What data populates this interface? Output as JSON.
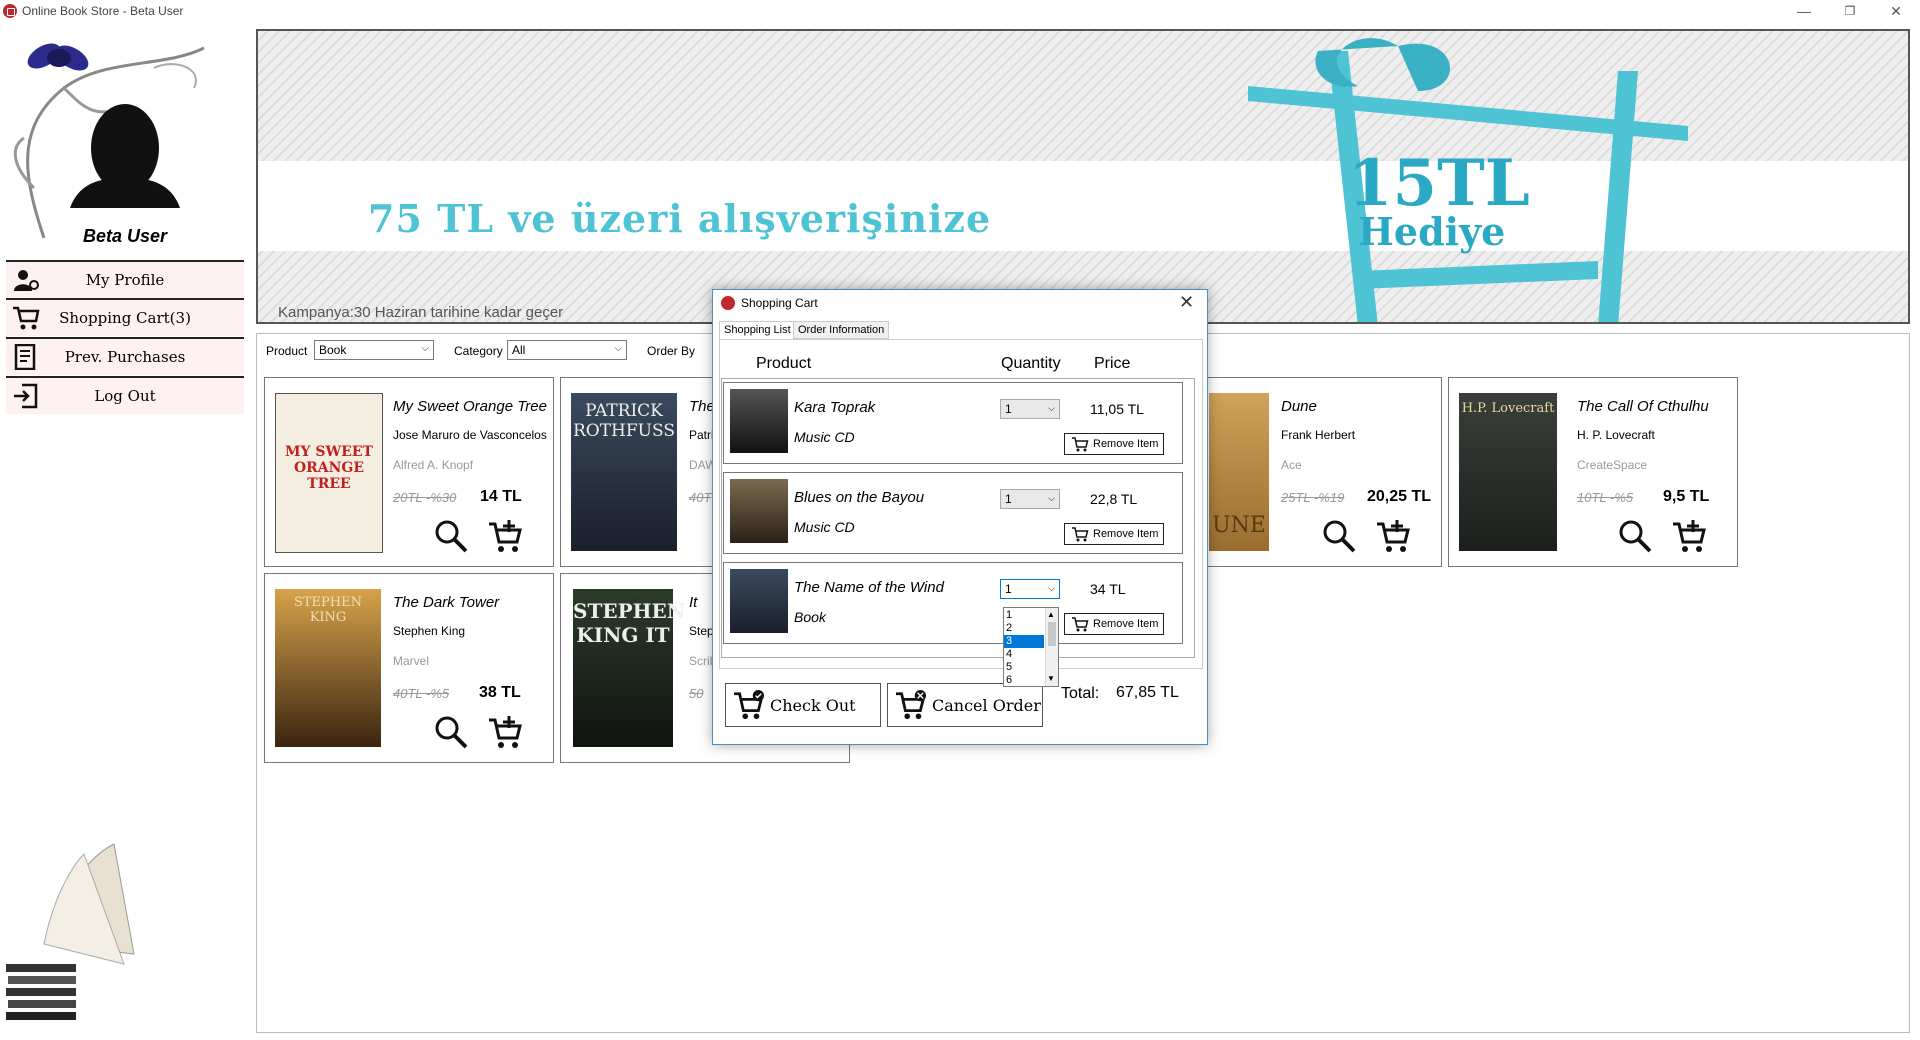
{
  "window": {
    "title": "Online Book Store - Beta User",
    "minimize": "—",
    "restore": "❐",
    "close": "✕"
  },
  "sidebar": {
    "user_name": "Beta User",
    "items": [
      {
        "label": "My Profile",
        "icon": "user-gear-icon"
      },
      {
        "label": "Shopping Cart(3)",
        "icon": "shopping-cart-icon"
      },
      {
        "label": "Prev. Purchases",
        "icon": "receipt-icon"
      },
      {
        "label": "Log Out",
        "icon": "logout-icon"
      }
    ]
  },
  "banner": {
    "headline": "75 TL ve üzeri alışverişinize",
    "amount": "15TL",
    "gift": "Hediye",
    "footnote": "Kampanya:30 Haziran tarihine kadar geçer"
  },
  "filters": {
    "product_label": "Product",
    "product_value": "Book",
    "category_label": "Category",
    "category_value": "All",
    "orderby_label": "Order By"
  },
  "products": [
    {
      "title": "My Sweet Orange Tree",
      "author": "Jose Maruro de Vasconcelos",
      "publisher": "Alfred A. Knopf",
      "old_price": "20TL -%30",
      "price": "14 TL",
      "cover_text": "MY SWEET ORANGE TREE"
    },
    {
      "title": "The",
      "author": "Patric",
      "publisher": "DAW",
      "old_price": "40T",
      "price": "",
      "cover_text": "PATRICK ROTHFUSS"
    },
    {
      "title": "Dune",
      "author": "Frank Herbert",
      "publisher": "Ace",
      "old_price": "25TL -%19",
      "price": "20,25 TL",
      "cover_text": "UNE"
    },
    {
      "title": "The Call Of Cthulhu",
      "author": "H. P. Lovecraft",
      "publisher": "CreateSpace",
      "old_price": "10TL -%5",
      "price": "9,5 TL",
      "cover_text": "H.P. Lovecraft"
    },
    {
      "title": "The Dark Tower",
      "author": "Stephen King",
      "publisher": "Marvel",
      "old_price": "40TL -%5",
      "price": "38 TL",
      "cover_text": "STEPHEN KING"
    },
    {
      "title": "It",
      "author": "Step",
      "publisher": "Scrib",
      "old_price": "50",
      "price": "",
      "cover_text": "STEPHEN KING IT"
    }
  ],
  "cart_dialog": {
    "title": "Shopping Cart",
    "close": "✕",
    "tabs": [
      "Shopping List",
      "Order Information"
    ],
    "headers": {
      "product": "Product",
      "quantity": "Quantity",
      "price": "Price"
    },
    "items": [
      {
        "name": "Kara Toprak",
        "type": "Music CD",
        "quantity": "1",
        "price": "11,05 TL",
        "remove": "Remove Item"
      },
      {
        "name": "Blues on the Bayou",
        "type": "Music CD",
        "quantity": "1",
        "price": "22,8 TL",
        "remove": "Remove Item"
      },
      {
        "name": "The Name of the Wind",
        "type": "Book",
        "quantity": "1",
        "price": "34 TL",
        "remove": "Remove Item"
      }
    ],
    "quantity_options": [
      "1",
      "2",
      "3",
      "4",
      "5",
      "6"
    ],
    "quantity_highlighted": "3",
    "checkout": "Check Out",
    "cancel": "Cancel Order",
    "total_label": "Total:",
    "total_value": "67,85 TL"
  }
}
